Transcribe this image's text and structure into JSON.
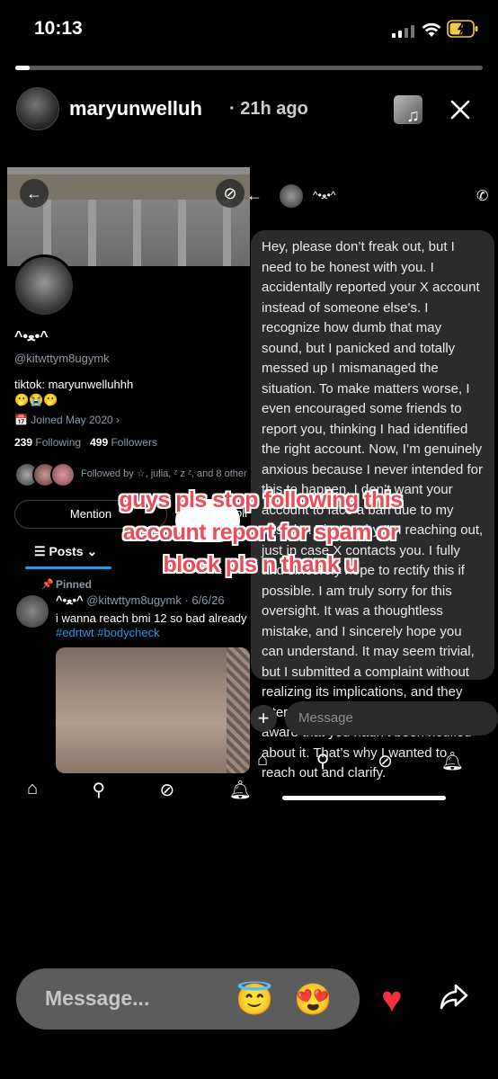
{
  "status": {
    "time": "10:13"
  },
  "story": {
    "username": "maryunwelluh",
    "time_ago": "· 21h ago",
    "progress": 0.03,
    "close_label": "✕"
  },
  "profile": {
    "display_name": "^•ﻌ•^",
    "handle": "@kitwttym8ugymk",
    "bio_line1": "tiktok: maryunwelluhhh",
    "bio_line2": "🫢😭🫢",
    "joined": "Joined May 2020",
    "following_count": "239",
    "following_label": "Following",
    "followers_count": "499",
    "followers_label": "Followers",
    "followed_by": "Followed by ☆, julia, ᶻ z ᶻ, and 8 other",
    "mention_label": "Mention",
    "oll_fragment": "oll",
    "tab_posts": "Posts"
  },
  "tweet": {
    "pinned_label": "Pinned",
    "author": "^•ﻌ•^",
    "meta": "@kitwttym8ugymk · 6/6/26",
    "text": "i wanna reach bmi 12 so bad already",
    "tags": "#edrtwt #bodycheck"
  },
  "dm": {
    "name": "^•ﻌ•^",
    "message": "Hey, please don’t freak out, but I need to be honest with you. I accidentally reported your X account instead of someone else's. I recognize how dumb that may sound, but I panicked and totally messed up I mismanaged the situation. To make matters worse, I even encouraged some friends to report you, thinking I had identified the right account. Now, I’m genuinely anxious because I never intended for this to happen. I don’t want your account to face a ban due to my mistake. That’s why I’m reaching out, just in case X contacts you. I fully and sincerely hope to rectify this if possible. I am truly sorry for this oversight. It was a thoughtless mistake, and I sincerely hope you can understand. It may seem trivial, but I submitted a complaint without realizing its implications, and they later emailed me, which made me aware that you hadn’t been notified about it. That’s why I wanted to reach out and clarify.",
    "input_placeholder": "Message",
    "plus": "+"
  },
  "overlay_text": {
    "line1": "guys pls stop following this",
    "line2": "account report for spam or",
    "line3": "block pls n thank u"
  },
  "reply_bar": {
    "placeholder": "Message...",
    "emoji1": "😇",
    "emoji2": "😍"
  },
  "icons": {
    "heart": "heart-icon",
    "share": "share-icon"
  },
  "colors": {
    "accent_blue": "#1d9bf0",
    "overlay_red": "#ec4b59",
    "heart_red": "#f2313c"
  }
}
